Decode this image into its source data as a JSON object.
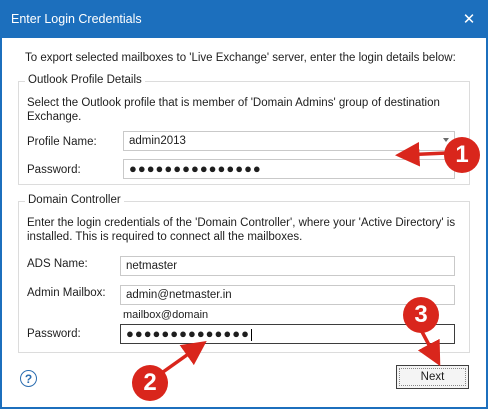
{
  "dialog": {
    "title": "Enter Login Credentials",
    "close_glyph": "✕"
  },
  "intro": "To export selected mailboxes to 'Live Exchange' server, enter the login details below:",
  "outlook_group": {
    "legend": "Outlook Profile Details",
    "description_line1": "Select the Outlook profile that is member of 'Domain Admins' group of destination",
    "description_line2": "Exchange.",
    "profile_label": "Profile Name:",
    "profile_value": "admin2013",
    "password_label": "Password:",
    "password_value": "●●●●●●●●●●●●●●●"
  },
  "domain_group": {
    "legend": "Domain Controller",
    "description_line1": "Enter the login credentials of the 'Domain Controller', where your 'Active Directory' is",
    "description_line2": "installed. This is required to connect all the mailboxes.",
    "ads_label": "ADS Name:",
    "ads_value": "netmaster",
    "mailbox_label": "Admin Mailbox:",
    "mailbox_value": "admin@netmaster.in",
    "mailbox_hint": "mailbox@domain",
    "password_label": "Password:",
    "password_value": "●●●●●●●●●●●●●●"
  },
  "footer": {
    "help_glyph": "?",
    "next_label": "Next"
  },
  "annotations": {
    "step1": "1",
    "step2": "2",
    "step3": "3",
    "color": "#d9261c"
  }
}
